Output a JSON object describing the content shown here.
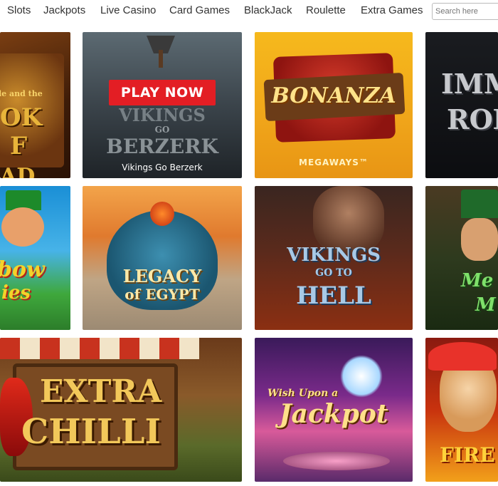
{
  "nav": {
    "items": [
      "Slots",
      "Jackpots",
      "Live Casino",
      "Card Games",
      "BlackJack",
      "Roulette",
      "Extra Games"
    ],
    "search_placeholder": "Search here"
  },
  "tiles": {
    "book_of_dead": {
      "title_line1": "le and the",
      "title_line2": "OK",
      "title_line3": "F",
      "title_line4": "AD"
    },
    "vikings_go_berzerk": {
      "title_line1": "VIKINGS",
      "title_line2": "GO",
      "title_line3": "BERZERK",
      "play_label": "PLAY NOW",
      "caption": "Vikings Go Berzerk"
    },
    "bonanza": {
      "title": "BONANZA",
      "subtitle": "MEGAWAYS™"
    },
    "immortal_romance": {
      "title_line1": "IMMO",
      "title_line2": "ROM"
    },
    "rainbow_riches": {
      "title_line1": "bow",
      "title_line2": "ies"
    },
    "legacy_of_egypt": {
      "title_line1": "LEGACY",
      "title_line2": "of EGYPT"
    },
    "vikings_go_to_hell": {
      "title_line1": "VIKINGS",
      "title_line2": "GO TO",
      "title_line3": "HELL"
    },
    "leprechaun": {
      "title_line1": "Me",
      "title_line2": "M"
    },
    "extra_chilli": {
      "title_line1": "EXTRA",
      "title_line2": "CHILLI"
    },
    "wish_upon_a_jackpot": {
      "title_line1": "Wish Upon a",
      "title_line2": "Jackpot"
    },
    "fire_joker": {
      "title": "FIRE J"
    }
  },
  "colors": {
    "play_button": "#e31e24",
    "nav_text": "#333333"
  }
}
